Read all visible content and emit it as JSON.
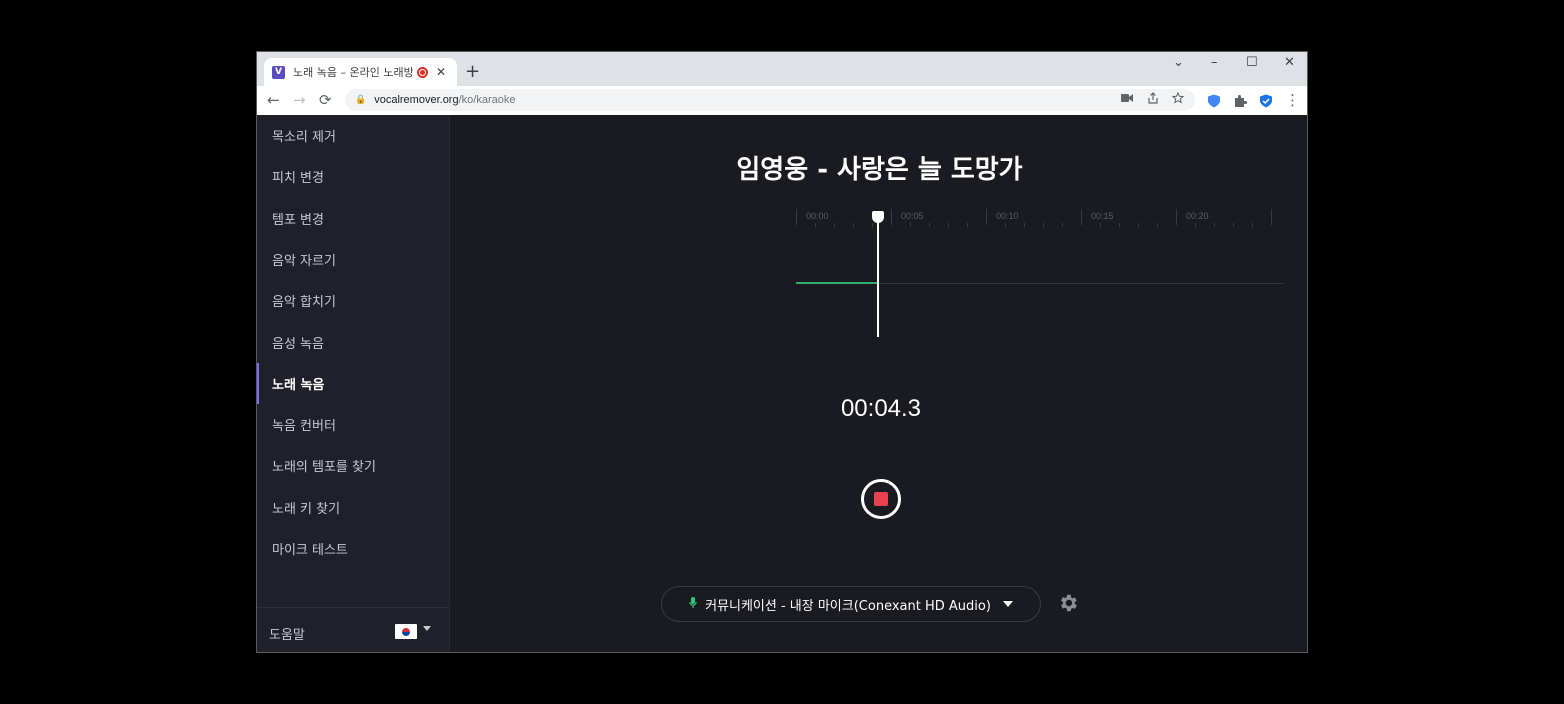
{
  "browser": {
    "tab": {
      "favicon": "V",
      "title": "노래 녹음 – 온라인 노래방 :",
      "close": "✕"
    },
    "new_tab": "+",
    "window_controls": {
      "tab_search": "⌄",
      "minimize": "–",
      "maximize": "☐",
      "close": "✕"
    },
    "nav": {
      "back": "←",
      "forward": "→",
      "reload": "⟳"
    },
    "url_host": "vocalremover.org",
    "url_path": "/ko/karaoke",
    "lock": "🔒",
    "menu": "⋮",
    "extension_colors": [
      "#4285f4",
      "#5f6368",
      "#1a73e8"
    ]
  },
  "sidebar": {
    "items": [
      {
        "label": "목소리 제거"
      },
      {
        "label": "피치 변경"
      },
      {
        "label": "템포 변경"
      },
      {
        "label": "음악 자르기"
      },
      {
        "label": "음악 합치기"
      },
      {
        "label": "음성 녹음"
      },
      {
        "label": "노래 녹음",
        "active": true
      },
      {
        "label": "녹음 컨버터"
      },
      {
        "label": "노래의 템포를 찾기"
      },
      {
        "label": "노래 키 찾기"
      },
      {
        "label": "마이크 테스트"
      }
    ],
    "help": "도움말",
    "language": "ko"
  },
  "main": {
    "song_title": "임영웅 - 사랑은 늘 도망가",
    "timeline": {
      "ticks": [
        "00:00",
        "00:05",
        "00:10",
        "00:15",
        "00:20"
      ],
      "position_seconds": 4.3,
      "seconds_per_major": 5
    },
    "timer": "00:04.3",
    "mic": {
      "label": "커뮤니케이션 - 내장 마이크(Conexant HD Audio)"
    },
    "accent": "#7b6cff",
    "record_color": "#e84152",
    "wave_color": "#2eae6b"
  }
}
